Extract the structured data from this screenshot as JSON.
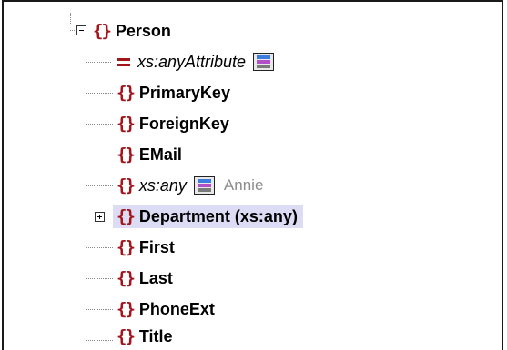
{
  "tree": {
    "root": {
      "label": "Person",
      "expanded": true,
      "icon": "element-icon"
    },
    "children": [
      {
        "label": "xs:anyAttribute",
        "kind": "attribute-wildcard",
        "icon": "attribute-icon",
        "has_wildcard_icon": true
      },
      {
        "label": "PrimaryKey",
        "kind": "element",
        "icon": "element-icon"
      },
      {
        "label": "ForeignKey",
        "kind": "element",
        "icon": "element-icon"
      },
      {
        "label": "EMail",
        "kind": "element",
        "icon": "element-icon"
      },
      {
        "label": "xs:any",
        "kind": "element-wildcard",
        "icon": "element-icon",
        "has_wildcard_icon": true,
        "sample_value": "Annie"
      },
      {
        "label": "Department (xs:any)",
        "kind": "element",
        "icon": "element-icon",
        "collapsed": true,
        "selected": true
      },
      {
        "label": "First",
        "kind": "element",
        "icon": "element-icon"
      },
      {
        "label": "Last",
        "kind": "element",
        "icon": "element-icon"
      },
      {
        "label": "PhoneExt",
        "kind": "element",
        "icon": "element-icon"
      },
      {
        "label": "Title",
        "kind": "element",
        "icon": "element-icon"
      }
    ]
  },
  "colors": {
    "element_icon": "#a3151b",
    "selection": "#dcdcf4",
    "guide_lines": "#8a8a8a",
    "sample_text": "#8c8c8c"
  }
}
